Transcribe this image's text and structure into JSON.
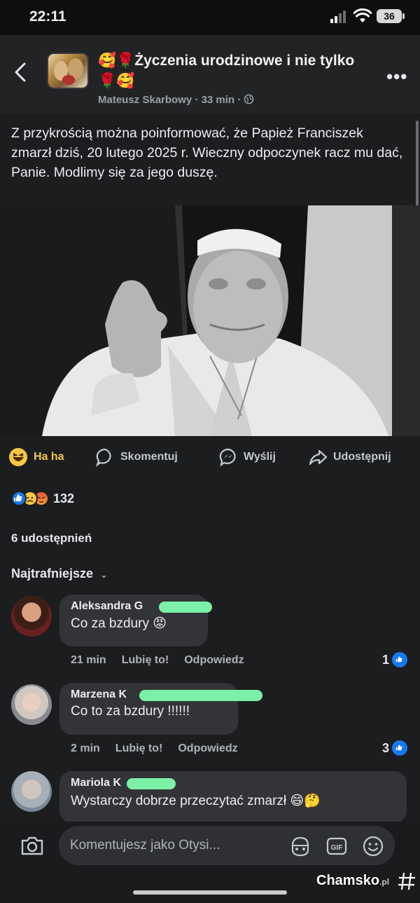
{
  "status_bar": {
    "time": "22:11",
    "battery": "36"
  },
  "header": {
    "title": "🥰🌹Życzenia urodzinowe i nie tylko🌹🥰",
    "author": "Mateusz Skarbowy",
    "time": "33 min",
    "more_label": "•••"
  },
  "post": {
    "text": "Z przykrością można poinformować, że Papież Franciszek zmarzł dziś, 20 lutego 2025 r. Wieczny odpoczynek racz mu dać, Panie. Modlimy się za jego duszę."
  },
  "actions": [
    {
      "label": "Ha ha",
      "icon": "haha-emoji-icon"
    },
    {
      "label": "Skomentuj",
      "icon": "comment-bubble-icon"
    },
    {
      "label": "Wyślij",
      "icon": "messenger-icon"
    },
    {
      "label": "Udostępnij",
      "icon": "share-arrow-icon"
    }
  ],
  "reactions": {
    "count": "132",
    "icons": [
      "like-icon",
      "sad-icon",
      "angry-icon"
    ]
  },
  "shares": "6 udostępnień",
  "sort_label": "Najtrafniejsze",
  "comments": [
    {
      "name": "Aleksandra G",
      "text": "Co za bzdury 😡",
      "time": "21 min",
      "like_label": "Lubię to!",
      "reply_label": "Odpowiedz",
      "likes": "1"
    },
    {
      "name": "Marzena K",
      "text": "Co to za bzdury !!!!!!",
      "time": "2 min",
      "like_label": "Lubię to!",
      "reply_label": "Odpowiedz",
      "likes": "3"
    },
    {
      "name": "Mariola K",
      "text": "Wystarczy dobrze przeczytać zmarzł 😄🤔"
    }
  ],
  "composer": {
    "placeholder": "Komentujesz jako Otysi..."
  },
  "watermark": {
    "brand": "Chamsko",
    "suffix": ".pl"
  },
  "colors": {
    "background": "#1c1d1f",
    "accent_blue": "#1877f2",
    "haha_yellow": "#f2c94c",
    "redaction_green": "#7cf0a6"
  }
}
